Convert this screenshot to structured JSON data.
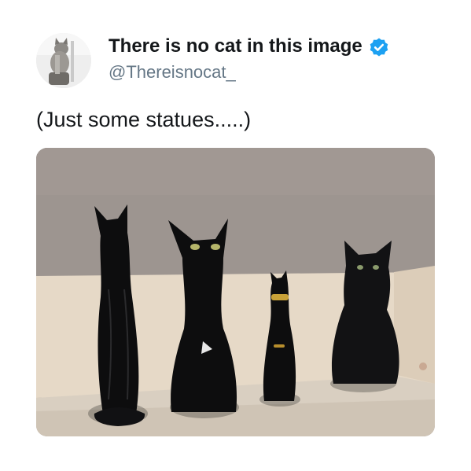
{
  "tweet": {
    "display_name": "There is no cat in this image",
    "handle": "@Thereisnocat_",
    "text": "(Just some statues.....)",
    "verified": true
  },
  "icons": {
    "avatar": "avatar-cat-photo",
    "verified": "verified-badge-icon"
  },
  "colors": {
    "verified_badge": "#1da1f2",
    "handle_text": "#657786",
    "name_text": "#14171a",
    "wall": "#9b948f",
    "shelf": "#e7dac9",
    "statue": "#0d0d0e"
  }
}
